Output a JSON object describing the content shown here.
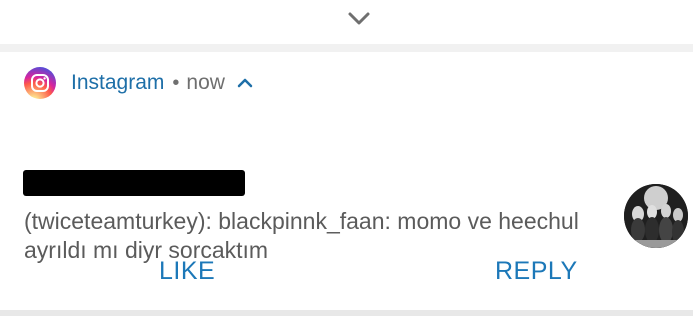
{
  "notification": {
    "app_name": "Instagram",
    "separator": "•",
    "time": "now",
    "message": "(twiceteamturkey): blackpinnk_faan: momo ve heechul ayrıldı mı diyr sorcaktım",
    "actions": {
      "like_label": "LIKE",
      "reply_label": "REPLY"
    }
  },
  "colors": {
    "app_accent": "#1e6fa8",
    "action_text": "#1c78b8",
    "secondary_text": "#6f6f6f",
    "body_text": "#5b5b5b"
  },
  "icons": {
    "expand": "chevron-down-icon",
    "collapse": "chevron-up-icon",
    "app": "instagram-icon"
  }
}
